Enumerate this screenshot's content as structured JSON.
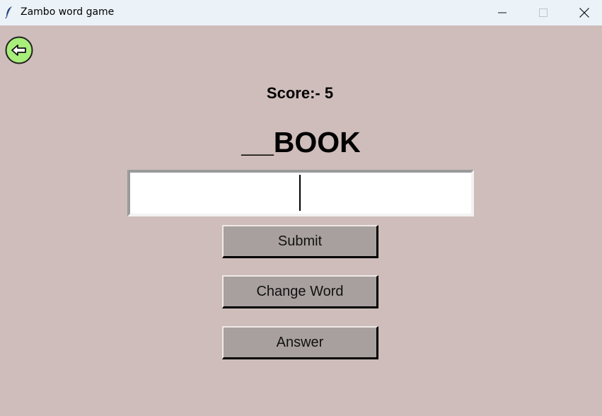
{
  "window": {
    "title": "Zambo word game"
  },
  "game": {
    "score_text": "Score:- 5",
    "word_display": "__BOOK",
    "input_value": ""
  },
  "buttons": {
    "submit": "Submit",
    "change_word": "Change Word",
    "answer": "Answer"
  },
  "icons": {
    "app": "feather-icon",
    "back": "back-arrow-icon",
    "minimize": "minimize-icon",
    "maximize": "maximize-icon",
    "close": "close-icon"
  },
  "colors": {
    "background": "#cebdba",
    "titlebar": "#ebf3f9",
    "button_face": "#a8a09e",
    "back_button": "#a8ee7a"
  }
}
